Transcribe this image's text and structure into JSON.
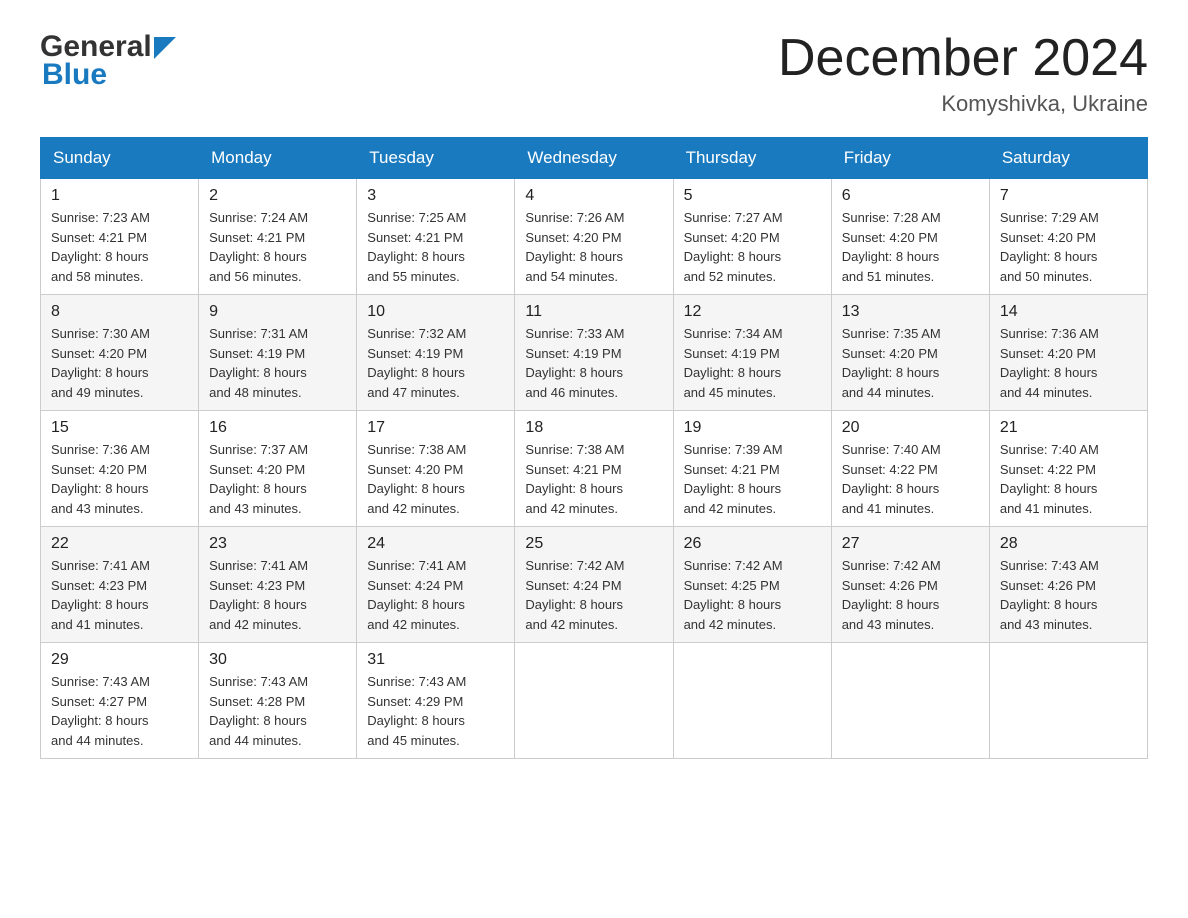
{
  "header": {
    "logo_general": "General",
    "logo_blue": "Blue",
    "title": "December 2024",
    "location": "Komyshivka, Ukraine"
  },
  "weekdays": [
    "Sunday",
    "Monday",
    "Tuesday",
    "Wednesday",
    "Thursday",
    "Friday",
    "Saturday"
  ],
  "weeks": [
    [
      {
        "day": "1",
        "sunrise": "7:23 AM",
        "sunset": "4:21 PM",
        "daylight": "8 hours and 58 minutes."
      },
      {
        "day": "2",
        "sunrise": "7:24 AM",
        "sunset": "4:21 PM",
        "daylight": "8 hours and 56 minutes."
      },
      {
        "day": "3",
        "sunrise": "7:25 AM",
        "sunset": "4:21 PM",
        "daylight": "8 hours and 55 minutes."
      },
      {
        "day": "4",
        "sunrise": "7:26 AM",
        "sunset": "4:20 PM",
        "daylight": "8 hours and 54 minutes."
      },
      {
        "day": "5",
        "sunrise": "7:27 AM",
        "sunset": "4:20 PM",
        "daylight": "8 hours and 52 minutes."
      },
      {
        "day": "6",
        "sunrise": "7:28 AM",
        "sunset": "4:20 PM",
        "daylight": "8 hours and 51 minutes."
      },
      {
        "day": "7",
        "sunrise": "7:29 AM",
        "sunset": "4:20 PM",
        "daylight": "8 hours and 50 minutes."
      }
    ],
    [
      {
        "day": "8",
        "sunrise": "7:30 AM",
        "sunset": "4:20 PM",
        "daylight": "8 hours and 49 minutes."
      },
      {
        "day": "9",
        "sunrise": "7:31 AM",
        "sunset": "4:19 PM",
        "daylight": "8 hours and 48 minutes."
      },
      {
        "day": "10",
        "sunrise": "7:32 AM",
        "sunset": "4:19 PM",
        "daylight": "8 hours and 47 minutes."
      },
      {
        "day": "11",
        "sunrise": "7:33 AM",
        "sunset": "4:19 PM",
        "daylight": "8 hours and 46 minutes."
      },
      {
        "day": "12",
        "sunrise": "7:34 AM",
        "sunset": "4:19 PM",
        "daylight": "8 hours and 45 minutes."
      },
      {
        "day": "13",
        "sunrise": "7:35 AM",
        "sunset": "4:20 PM",
        "daylight": "8 hours and 44 minutes."
      },
      {
        "day": "14",
        "sunrise": "7:36 AM",
        "sunset": "4:20 PM",
        "daylight": "8 hours and 44 minutes."
      }
    ],
    [
      {
        "day": "15",
        "sunrise": "7:36 AM",
        "sunset": "4:20 PM",
        "daylight": "8 hours and 43 minutes."
      },
      {
        "day": "16",
        "sunrise": "7:37 AM",
        "sunset": "4:20 PM",
        "daylight": "8 hours and 43 minutes."
      },
      {
        "day": "17",
        "sunrise": "7:38 AM",
        "sunset": "4:20 PM",
        "daylight": "8 hours and 42 minutes."
      },
      {
        "day": "18",
        "sunrise": "7:38 AM",
        "sunset": "4:21 PM",
        "daylight": "8 hours and 42 minutes."
      },
      {
        "day": "19",
        "sunrise": "7:39 AM",
        "sunset": "4:21 PM",
        "daylight": "8 hours and 42 minutes."
      },
      {
        "day": "20",
        "sunrise": "7:40 AM",
        "sunset": "4:22 PM",
        "daylight": "8 hours and 41 minutes."
      },
      {
        "day": "21",
        "sunrise": "7:40 AM",
        "sunset": "4:22 PM",
        "daylight": "8 hours and 41 minutes."
      }
    ],
    [
      {
        "day": "22",
        "sunrise": "7:41 AM",
        "sunset": "4:23 PM",
        "daylight": "8 hours and 41 minutes."
      },
      {
        "day": "23",
        "sunrise": "7:41 AM",
        "sunset": "4:23 PM",
        "daylight": "8 hours and 42 minutes."
      },
      {
        "day": "24",
        "sunrise": "7:41 AM",
        "sunset": "4:24 PM",
        "daylight": "8 hours and 42 minutes."
      },
      {
        "day": "25",
        "sunrise": "7:42 AM",
        "sunset": "4:24 PM",
        "daylight": "8 hours and 42 minutes."
      },
      {
        "day": "26",
        "sunrise": "7:42 AM",
        "sunset": "4:25 PM",
        "daylight": "8 hours and 42 minutes."
      },
      {
        "day": "27",
        "sunrise": "7:42 AM",
        "sunset": "4:26 PM",
        "daylight": "8 hours and 43 minutes."
      },
      {
        "day": "28",
        "sunrise": "7:43 AM",
        "sunset": "4:26 PM",
        "daylight": "8 hours and 43 minutes."
      }
    ],
    [
      {
        "day": "29",
        "sunrise": "7:43 AM",
        "sunset": "4:27 PM",
        "daylight": "8 hours and 44 minutes."
      },
      {
        "day": "30",
        "sunrise": "7:43 AM",
        "sunset": "4:28 PM",
        "daylight": "8 hours and 44 minutes."
      },
      {
        "day": "31",
        "sunrise": "7:43 AM",
        "sunset": "4:29 PM",
        "daylight": "8 hours and 45 minutes."
      },
      null,
      null,
      null,
      null
    ]
  ],
  "labels": {
    "sunrise": "Sunrise:",
    "sunset": "Sunset:",
    "daylight": "Daylight:"
  }
}
